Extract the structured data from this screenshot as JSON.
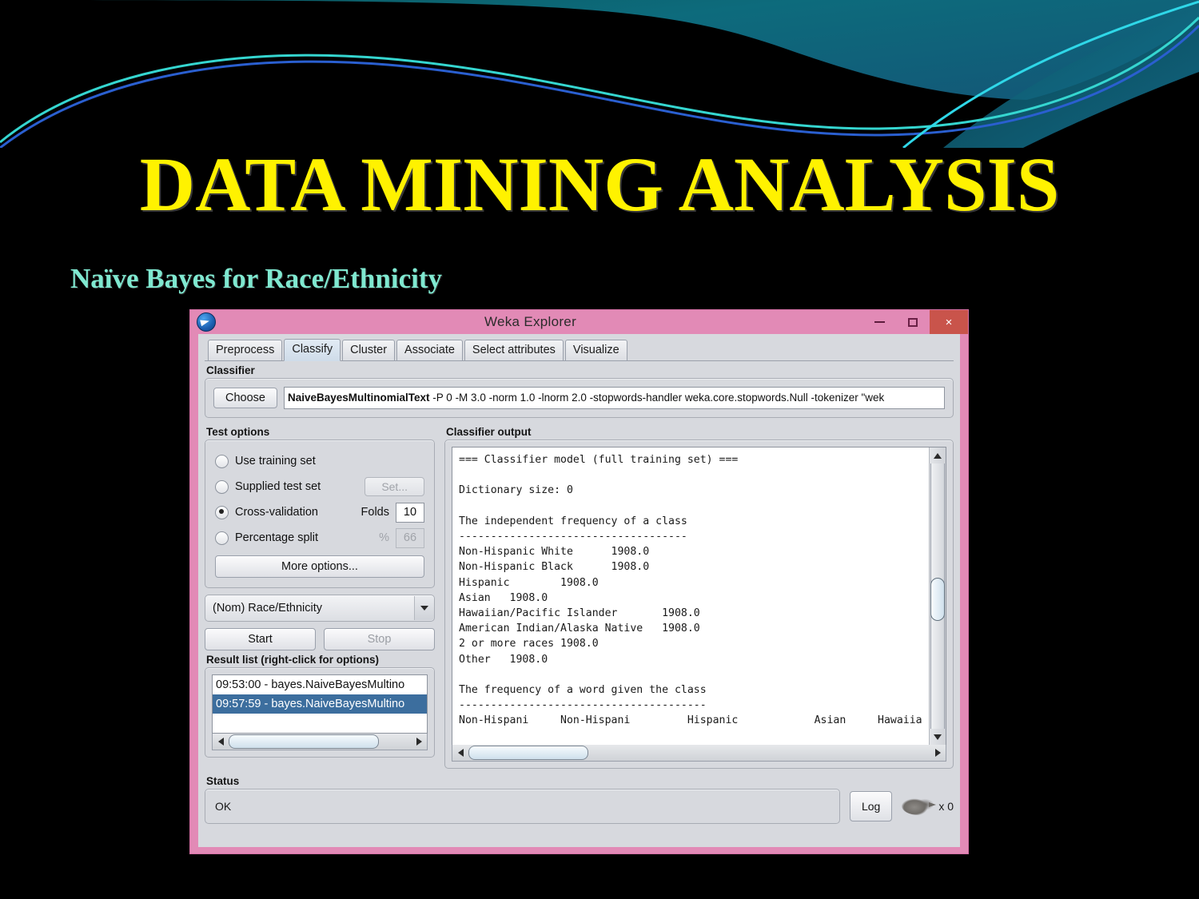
{
  "slide": {
    "title": "DATA MINING ANALYSIS",
    "subtitle": "Naïve Bayes for Race/Ethnicity",
    "title_color": "#FFF200",
    "subtitle_color": "#7FE8D0",
    "background_color": "#000000"
  },
  "window": {
    "title": "Weka Explorer",
    "logo_icon": "weka-bird-icon",
    "frame_color": "#e28ab6",
    "close_color": "#c9544b",
    "minimize_label": "–",
    "maximize_label": "□",
    "close_label": "×"
  },
  "tabs": [
    {
      "label": "Preprocess",
      "active": false
    },
    {
      "label": "Classify",
      "active": true
    },
    {
      "label": "Cluster",
      "active": false
    },
    {
      "label": "Associate",
      "active": false
    },
    {
      "label": "Select attributes",
      "active": false
    },
    {
      "label": "Visualize",
      "active": false
    }
  ],
  "classifier": {
    "group_label": "Classifier",
    "choose_label": "Choose",
    "scheme_name": "NaiveBayesMultinomialText",
    "scheme_options": " -P 0 -M 3.0 -norm 1.0 -lnorm 2.0 -stopwords-handler weka.core.stopwords.Null -tokenizer \"wek"
  },
  "test_options": {
    "group_label": "Test options",
    "options": [
      {
        "label": "Use training set",
        "selected": false
      },
      {
        "label": "Supplied test set",
        "selected": false
      },
      {
        "label": "Cross-validation",
        "selected": true
      },
      {
        "label": "Percentage split",
        "selected": false
      }
    ],
    "set_button": "Set...",
    "folds_label": "Folds",
    "folds_value": "10",
    "percent_symbol": "%",
    "percent_value": "66",
    "more_options_label": "More options..."
  },
  "class_selector": {
    "value": "(Nom) Race/Ethnicity"
  },
  "actions": {
    "start_label": "Start",
    "stop_label": "Stop"
  },
  "result_list": {
    "group_label": "Result list (right-click for options)",
    "items": [
      {
        "label": "09:53:00 - bayes.NaiveBayesMultino",
        "selected": false
      },
      {
        "label": "09:57:59 - bayes.NaiveBayesMultino",
        "selected": true
      }
    ]
  },
  "classifier_output": {
    "group_label": "Classifier output",
    "text": "=== Classifier model (full training set) ===\n\nDictionary size: 0\n\nThe independent frequency of a class\n------------------------------------\nNon-Hispanic White      1908.0\nNon-Hispanic Black      1908.0\nHispanic        1908.0\nAsian   1908.0\nHawaiian/Pacific Islander       1908.0\nAmerican Indian/Alaska Native   1908.0\n2 or more races 1908.0\nOther   1908.0\n\nThe frequency of a word given the class\n---------------------------------------\nNon-Hispani     Non-Hispani         Hispanic            Asian     Hawaiia"
  },
  "status": {
    "group_label": "Status",
    "value": "OK",
    "log_label": "Log",
    "bird_icon": "weka-kiwi-icon",
    "bird_count": "x 0"
  }
}
